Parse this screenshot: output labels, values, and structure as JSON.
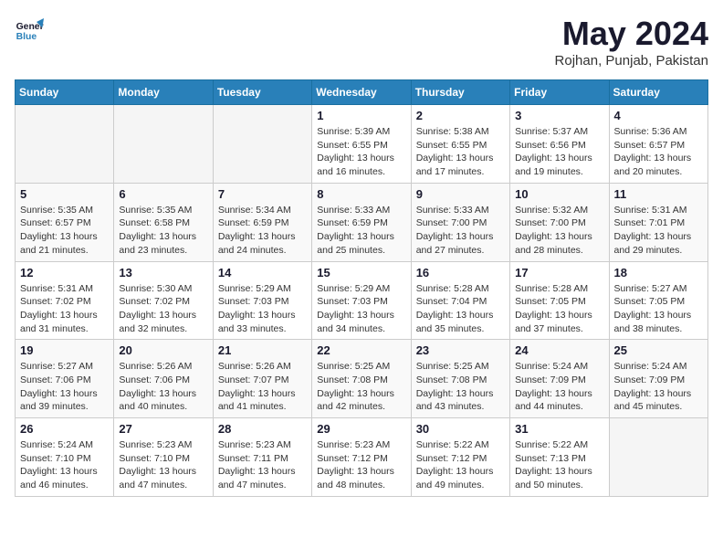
{
  "header": {
    "logo_line1": "General",
    "logo_line2": "Blue",
    "month_year": "May 2024",
    "location": "Rojhan, Punjab, Pakistan"
  },
  "days_of_week": [
    "Sunday",
    "Monday",
    "Tuesday",
    "Wednesday",
    "Thursday",
    "Friday",
    "Saturday"
  ],
  "weeks": [
    [
      {
        "num": "",
        "info": ""
      },
      {
        "num": "",
        "info": ""
      },
      {
        "num": "",
        "info": ""
      },
      {
        "num": "1",
        "info": "Sunrise: 5:39 AM\nSunset: 6:55 PM\nDaylight: 13 hours and 16 minutes."
      },
      {
        "num": "2",
        "info": "Sunrise: 5:38 AM\nSunset: 6:55 PM\nDaylight: 13 hours and 17 minutes."
      },
      {
        "num": "3",
        "info": "Sunrise: 5:37 AM\nSunset: 6:56 PM\nDaylight: 13 hours and 19 minutes."
      },
      {
        "num": "4",
        "info": "Sunrise: 5:36 AM\nSunset: 6:57 PM\nDaylight: 13 hours and 20 minutes."
      }
    ],
    [
      {
        "num": "5",
        "info": "Sunrise: 5:35 AM\nSunset: 6:57 PM\nDaylight: 13 hours and 21 minutes."
      },
      {
        "num": "6",
        "info": "Sunrise: 5:35 AM\nSunset: 6:58 PM\nDaylight: 13 hours and 23 minutes."
      },
      {
        "num": "7",
        "info": "Sunrise: 5:34 AM\nSunset: 6:59 PM\nDaylight: 13 hours and 24 minutes."
      },
      {
        "num": "8",
        "info": "Sunrise: 5:33 AM\nSunset: 6:59 PM\nDaylight: 13 hours and 25 minutes."
      },
      {
        "num": "9",
        "info": "Sunrise: 5:33 AM\nSunset: 7:00 PM\nDaylight: 13 hours and 27 minutes."
      },
      {
        "num": "10",
        "info": "Sunrise: 5:32 AM\nSunset: 7:00 PM\nDaylight: 13 hours and 28 minutes."
      },
      {
        "num": "11",
        "info": "Sunrise: 5:31 AM\nSunset: 7:01 PM\nDaylight: 13 hours and 29 minutes."
      }
    ],
    [
      {
        "num": "12",
        "info": "Sunrise: 5:31 AM\nSunset: 7:02 PM\nDaylight: 13 hours and 31 minutes."
      },
      {
        "num": "13",
        "info": "Sunrise: 5:30 AM\nSunset: 7:02 PM\nDaylight: 13 hours and 32 minutes."
      },
      {
        "num": "14",
        "info": "Sunrise: 5:29 AM\nSunset: 7:03 PM\nDaylight: 13 hours and 33 minutes."
      },
      {
        "num": "15",
        "info": "Sunrise: 5:29 AM\nSunset: 7:03 PM\nDaylight: 13 hours and 34 minutes."
      },
      {
        "num": "16",
        "info": "Sunrise: 5:28 AM\nSunset: 7:04 PM\nDaylight: 13 hours and 35 minutes."
      },
      {
        "num": "17",
        "info": "Sunrise: 5:28 AM\nSunset: 7:05 PM\nDaylight: 13 hours and 37 minutes."
      },
      {
        "num": "18",
        "info": "Sunrise: 5:27 AM\nSunset: 7:05 PM\nDaylight: 13 hours and 38 minutes."
      }
    ],
    [
      {
        "num": "19",
        "info": "Sunrise: 5:27 AM\nSunset: 7:06 PM\nDaylight: 13 hours and 39 minutes."
      },
      {
        "num": "20",
        "info": "Sunrise: 5:26 AM\nSunset: 7:06 PM\nDaylight: 13 hours and 40 minutes."
      },
      {
        "num": "21",
        "info": "Sunrise: 5:26 AM\nSunset: 7:07 PM\nDaylight: 13 hours and 41 minutes."
      },
      {
        "num": "22",
        "info": "Sunrise: 5:25 AM\nSunset: 7:08 PM\nDaylight: 13 hours and 42 minutes."
      },
      {
        "num": "23",
        "info": "Sunrise: 5:25 AM\nSunset: 7:08 PM\nDaylight: 13 hours and 43 minutes."
      },
      {
        "num": "24",
        "info": "Sunrise: 5:24 AM\nSunset: 7:09 PM\nDaylight: 13 hours and 44 minutes."
      },
      {
        "num": "25",
        "info": "Sunrise: 5:24 AM\nSunset: 7:09 PM\nDaylight: 13 hours and 45 minutes."
      }
    ],
    [
      {
        "num": "26",
        "info": "Sunrise: 5:24 AM\nSunset: 7:10 PM\nDaylight: 13 hours and 46 minutes."
      },
      {
        "num": "27",
        "info": "Sunrise: 5:23 AM\nSunset: 7:10 PM\nDaylight: 13 hours and 47 minutes."
      },
      {
        "num": "28",
        "info": "Sunrise: 5:23 AM\nSunset: 7:11 PM\nDaylight: 13 hours and 47 minutes."
      },
      {
        "num": "29",
        "info": "Sunrise: 5:23 AM\nSunset: 7:12 PM\nDaylight: 13 hours and 48 minutes."
      },
      {
        "num": "30",
        "info": "Sunrise: 5:22 AM\nSunset: 7:12 PM\nDaylight: 13 hours and 49 minutes."
      },
      {
        "num": "31",
        "info": "Sunrise: 5:22 AM\nSunset: 7:13 PM\nDaylight: 13 hours and 50 minutes."
      },
      {
        "num": "",
        "info": ""
      }
    ]
  ]
}
